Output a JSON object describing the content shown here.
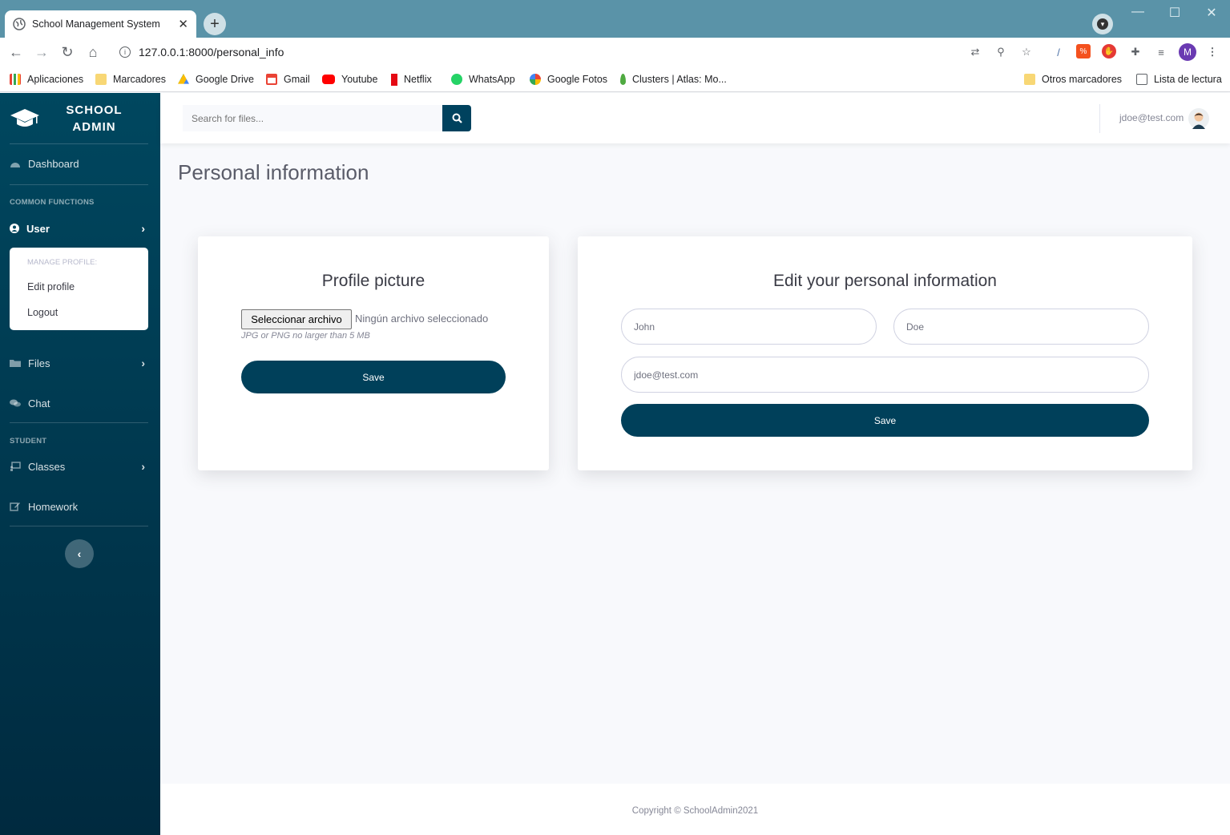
{
  "browser": {
    "tab_title": "School Management System",
    "tab_close": "✕",
    "new_tab": "+",
    "url": "127.0.0.1:8000/personal_info",
    "profile_initial": "M",
    "bookmarks": [
      "Aplicaciones",
      "Marcadores",
      "Google Drive",
      "Gmail",
      "Youtube",
      "Netflix",
      "WhatsApp",
      "Google Fotos",
      "Clusters | Atlas: Mo..."
    ],
    "bookmarks_right": [
      "Otros marcadores",
      "Lista de lectura"
    ]
  },
  "sidebar": {
    "brand_line1": "SCHOOL",
    "brand_line2": "ADMIN",
    "dashboard": "Dashboard",
    "section_common": "COMMON FUNCTIONS",
    "user": "User",
    "submenu_header": "MANAGE PROFILE:",
    "edit_profile": "Edit profile",
    "logout": "Logout",
    "files": "Files",
    "chat": "Chat",
    "section_student": "STUDENT",
    "classes": "Classes",
    "homework": "Homework"
  },
  "topbar": {
    "search_placeholder": "Search for files...",
    "user_email": "jdoe@test.com"
  },
  "page": {
    "title": "Personal information"
  },
  "profile_card": {
    "title": "Profile picture",
    "file_button": "Seleccionar archivo",
    "file_status": "Ningún archivo seleccionado",
    "hint": "JPG or PNG no larger than 5 MB",
    "save": "Save"
  },
  "info_card": {
    "title": "Edit your personal information",
    "first_name": "John",
    "last_name": "Doe",
    "email": "jdoe@test.com",
    "save": "Save"
  },
  "footer": {
    "copyright": "Copyright © SchoolAdmin2021"
  },
  "colors": {
    "primary": "#00425e",
    "sidebar_top": "#00475f",
    "sidebar_bottom": "#002a3f",
    "chrome": "#5a93a8"
  }
}
